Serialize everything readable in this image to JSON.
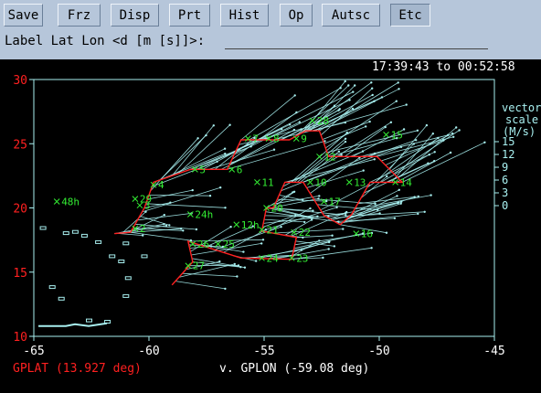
{
  "toolbar": {
    "buttons": [
      {
        "label": "Save"
      },
      {
        "label": "Frz"
      },
      {
        "label": "Disp"
      },
      {
        "label": "Prt"
      },
      {
        "label": "Hist"
      },
      {
        "label": "Op"
      },
      {
        "label": "Autsc"
      },
      {
        "label": "Etc"
      }
    ],
    "pressed_button": "Etc"
  },
  "label_entry": {
    "prompt": "Label Lat Lon <d [m [s]]>:",
    "value": ""
  },
  "time_range": "17:39:43 to 00:52:58",
  "colors": {
    "toolbar_bg": "#b6c6da",
    "plot_bg": "#000000",
    "axes": "#a8f0f0",
    "vectors": "#a8f0f0",
    "track": "#ff2020",
    "waypoints": "#33ee33",
    "y_axis_label": "#ff2020",
    "x_axis_label": "#ffffff"
  },
  "chart_data": {
    "type": "scatter",
    "xlabel": "v. GPLON (-59.08 deg)",
    "ylabel": "GPLAT (13.927 deg)",
    "xlim": [
      -65,
      -45
    ],
    "ylim": [
      10,
      30
    ],
    "x_ticks": [
      "-65",
      "-60",
      "-55",
      "-50",
      "-45"
    ],
    "y_ticks": [
      "10",
      "15",
      "20",
      "25",
      "30"
    ],
    "vector_scale": {
      "title": "vector",
      "subtitle": "scale",
      "units": "(M/s)",
      "ticks": [
        "15",
        "12",
        "9",
        "6",
        "3",
        "0"
      ]
    },
    "waypoints": [
      {
        "label": "48h",
        "lon": -64.0,
        "lat": 20.5
      },
      {
        "label": "24h",
        "lon": -58.2,
        "lat": 19.5
      },
      {
        "label": "12h",
        "lon": -56.2,
        "lat": 18.7
      },
      {
        "label": "2",
        "lon": -60.6,
        "lat": 18.4
      },
      {
        "label": "3",
        "lon": -60.4,
        "lat": 20.2
      },
      {
        "label": "4",
        "lon": -59.8,
        "lat": 21.8
      },
      {
        "label": "5",
        "lon": -58.0,
        "lat": 23.0
      },
      {
        "label": "6",
        "lon": -56.4,
        "lat": 23.0
      },
      {
        "label": "7",
        "lon": -55.7,
        "lat": 25.4
      },
      {
        "label": "8",
        "lon": -54.8,
        "lat": 25.4
      },
      {
        "label": "9",
        "lon": -53.6,
        "lat": 25.4
      },
      {
        "label": "10",
        "lon": -53.0,
        "lat": 22.0
      },
      {
        "label": "11",
        "lon": -55.3,
        "lat": 22.0
      },
      {
        "label": "12",
        "lon": -52.6,
        "lat": 24.0
      },
      {
        "label": "13",
        "lon": -51.3,
        "lat": 22.0
      },
      {
        "label": "14",
        "lon": -49.3,
        "lat": 22.0
      },
      {
        "label": "15",
        "lon": -49.7,
        "lat": 25.7
      },
      {
        "label": "16",
        "lon": -51.0,
        "lat": 18.0
      },
      {
        "label": "17",
        "lon": -52.4,
        "lat": 20.5
      },
      {
        "label": "20",
        "lon": -54.9,
        "lat": 20.0
      },
      {
        "label": "21",
        "lon": -55.1,
        "lat": 18.3
      },
      {
        "label": "22",
        "lon": -53.7,
        "lat": 18.1
      },
      {
        "label": "23",
        "lon": -53.8,
        "lat": 16.1
      },
      {
        "label": "24",
        "lon": -55.1,
        "lat": 16.1
      },
      {
        "label": "25",
        "lon": -57.0,
        "lat": 17.2
      },
      {
        "label": "26",
        "lon": -58.1,
        "lat": 17.2
      },
      {
        "label": "27",
        "lon": -58.3,
        "lat": 15.5
      },
      {
        "label": "28",
        "lon": -52.9,
        "lat": 26.8
      },
      {
        "label": "29",
        "lon": -60.6,
        "lat": 20.7
      }
    ],
    "track": [
      [
        -61.5,
        18.0
      ],
      [
        -60.8,
        18.1
      ],
      [
        -60.2,
        20.0
      ],
      [
        -59.8,
        22.0
      ],
      [
        -58.2,
        23.0
      ],
      [
        -56.6,
        23.0
      ],
      [
        -56.0,
        25.3
      ],
      [
        -53.9,
        25.3
      ],
      [
        -53.2,
        26.0
      ],
      [
        -52.6,
        26.0
      ],
      [
        -52.2,
        24.0
      ],
      [
        -50.1,
        24.0
      ],
      [
        -49.0,
        22.0
      ],
      [
        -50.4,
        22.0
      ],
      [
        -51.2,
        19.5
      ],
      [
        -51.7,
        18.7
      ],
      [
        -52.4,
        19.4
      ],
      [
        -53.3,
        22.0
      ],
      [
        -54.1,
        22.0
      ],
      [
        -54.6,
        20.0
      ],
      [
        -54.9,
        20.0
      ],
      [
        -55.1,
        18.2
      ],
      [
        -53.6,
        17.7
      ],
      [
        -53.8,
        16.0
      ],
      [
        -56.0,
        16.1
      ],
      [
        -58.3,
        17.4
      ],
      [
        -58.1,
        15.8
      ],
      [
        -59.0,
        14.0
      ]
    ]
  }
}
